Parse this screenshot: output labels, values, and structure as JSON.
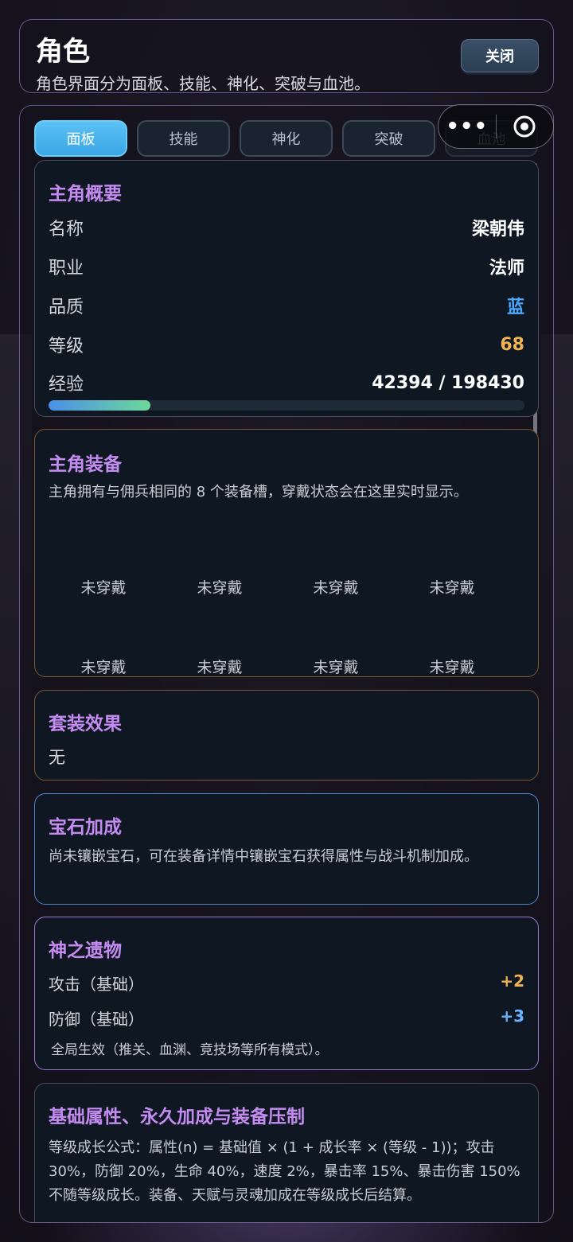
{
  "header": {
    "title": "角色",
    "subtitle": "角色界面分为面板、技能、神化、突破与血池。",
    "close_label": "关闭"
  },
  "tabs": [
    {
      "label": "面板",
      "active": true
    },
    {
      "label": "技能",
      "active": false
    },
    {
      "label": "神化",
      "active": false
    },
    {
      "label": "突破",
      "active": false
    },
    {
      "label": "血池",
      "active": false
    }
  ],
  "capsule": {
    "more_icon": "•••",
    "close_icon": "target-icon"
  },
  "overview": {
    "title": "主角概要",
    "rows": [
      {
        "label": "名称",
        "value": "梁朝伟"
      },
      {
        "label": "职业",
        "value": "法师"
      },
      {
        "label": "品质",
        "value": "蓝"
      },
      {
        "label": "等级",
        "value": "68"
      },
      {
        "label": "经验",
        "value": "42394 / 198430"
      }
    ],
    "exp_progress": 0.214,
    "quality_color": "#4aa8ff",
    "level_color": "#f0b450"
  },
  "equipment": {
    "title": "主角装备",
    "description": "主角拥有与佣兵相同的 8 个装备槽，穿戴状态会在这里实时显示。",
    "slots": [
      "未穿戴",
      "未穿戴",
      "未穿戴",
      "未穿戴",
      "未穿戴",
      "未穿戴",
      "未穿戴",
      "未穿戴"
    ]
  },
  "set_effect": {
    "title": "套装效果",
    "value": "无"
  },
  "gem": {
    "title": "宝石加成",
    "description": "尚未镶嵌宝石，可在装备详情中镶嵌宝石获得属性与战斗机制加成。"
  },
  "relic": {
    "title": "神之遗物",
    "rows": [
      {
        "label": "攻击（基础）",
        "value": "+2"
      },
      {
        "label": "防御（基础）",
        "value": "+3"
      }
    ],
    "note": "全局生效（推关、血渊、竞技场等所有模式）。"
  },
  "base": {
    "title": "基础属性、永久加成与装备压制",
    "description": "等级成长公式：属性(n) = 基础值 × (1 + 成长率 × (等级 - 1))；攻击 30%，防御 20%，生命 40%，速度 2%，暴击率 15%、暴击伤害 150% 不随等级成长。装备、天赋与灵魂加成在等级成长后结算。"
  }
}
